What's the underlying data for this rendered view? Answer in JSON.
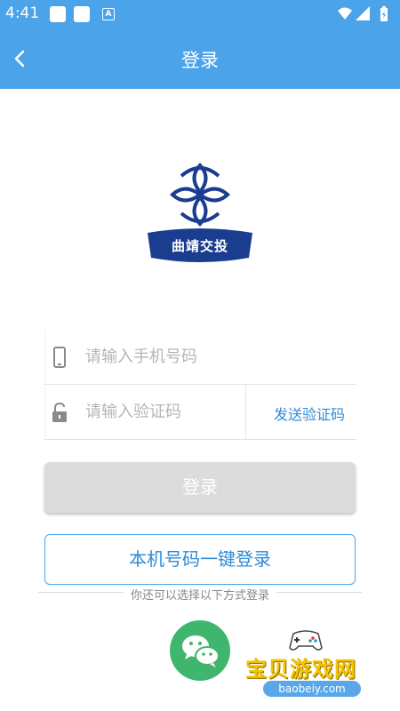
{
  "status_bar": {
    "time": "4:41",
    "icons": [
      "notification-icon",
      "notification-icon",
      "a-notification-icon",
      "wifi-icon",
      "signal-icon",
      "battery-charging-icon"
    ],
    "a_glyph": "A"
  },
  "app_bar": {
    "title": "登录",
    "back_icon": "chevron-left-icon"
  },
  "logo": {
    "text": "曲靖交投",
    "color": "#1a3d8f"
  },
  "form": {
    "phone": {
      "placeholder": "请输入手机号码",
      "value": "",
      "icon": "phone-icon"
    },
    "code": {
      "placeholder": "请输入验证码",
      "value": "",
      "icon": "lock-icon"
    },
    "send_code_label": "发送验证码"
  },
  "login_button_label": "登录",
  "onekey_button_label": "本机号码一键登录",
  "other_methods_label": "你还可以选择以下方式登录",
  "wechat_icon": "wechat-icon",
  "watermark": {
    "text": "宝贝游戏网",
    "url": "baobeiy.com"
  },
  "colors": {
    "primary": "#4ba3ea",
    "link": "#2f8bd6",
    "disabled": "#dcdcdc",
    "wechat": "#3fb56d"
  }
}
